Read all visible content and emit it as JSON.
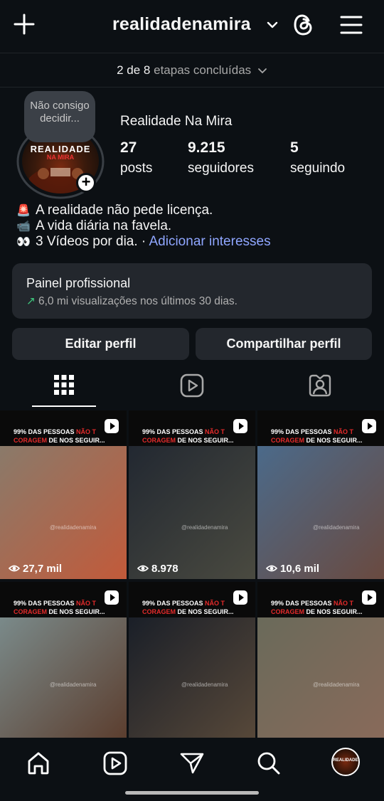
{
  "header": {
    "username": "realidadenamira",
    "icons": [
      "plus-icon",
      "chevron-down-icon",
      "threads-icon",
      "menu-icon"
    ]
  },
  "steps": {
    "done": "2 de 8",
    "rest": "etapas concluídas"
  },
  "profile": {
    "note_bubble": "Não consigo decidir...",
    "avatar_text": "REALIDADE",
    "avatar_sub": "NA MIRA",
    "name": "Realidade Na Mira",
    "stats": [
      {
        "number": "27",
        "label": "posts"
      },
      {
        "number": "9.215",
        "label": "seguidores"
      },
      {
        "number": "5",
        "label": "seguindo"
      }
    ],
    "bio": [
      {
        "icon": "🚨",
        "text": "A realidade não pede licença."
      },
      {
        "icon": "📹",
        "text": "A vida diária na favela."
      },
      {
        "icon": "👀",
        "text": "3 Vídeos por dia. · ",
        "link": "Adicionar interesses"
      }
    ]
  },
  "painel": {
    "title": "Painel profissional",
    "subtitle": "6,0 mi visualizações nos últimos 30 dias."
  },
  "buttons": {
    "edit": "Editar perfil",
    "share": "Compartilhar perfil"
  },
  "tabs": [
    "grid-tab",
    "reels-tab",
    "tagged-tab"
  ],
  "grid": [
    {
      "l1": "99% DAS PESSOAS ",
      "red1": "NÃO T",
      "red2": "CORAGEM",
      "l2": " DE NOS SEGUIR...",
      "views": "27,7 mil",
      "wm": "@realidadenamira",
      "bg1": "#8a7a6a",
      "bg2": "#c25a3a"
    },
    {
      "l1": "99% DAS PESSOAS ",
      "red1": "NÃO T",
      "red2": "CORAGEM",
      "l2": " DE NOS SEGUIR...",
      "views": "8.978",
      "wm": "@realidadenamira",
      "bg1": "#222831",
      "bg2": "#4a4a40"
    },
    {
      "l1": "99% DAS PESSOAS ",
      "red1": "NÃO T",
      "red2": "CORAGEM",
      "l2": " DE NOS SEGUIR...",
      "views": "10,6 mil",
      "wm": "@realidadenamira",
      "bg1": "#4b6a8a",
      "bg2": "#6a4a40"
    },
    {
      "l1": "99% DAS PESSOAS ",
      "red1": "NÃO T",
      "red2": "CORAGEM",
      "l2": " DE NOS SEGUIR...",
      "views": "",
      "wm": "@realidadenamira",
      "bg1": "#7a8a8a",
      "bg2": "#5a3a2a"
    },
    {
      "l1": "99% DAS PESSOAS ",
      "red1": "NÃO T",
      "red2": "CORAGEM",
      "l2": " DE NOS SEGUIR...",
      "views": "",
      "wm": "@realidadenamira",
      "bg1": "#1a1f28",
      "bg2": "#5a4a3a"
    },
    {
      "l1": "99% DAS PESSOAS ",
      "red1": "NÃO T",
      "red2": "CORAGEM",
      "l2": " DE NOS SEGUIR...",
      "views": "",
      "wm": "@realidadenamira",
      "bg1": "#6a6a5a",
      "bg2": "#8a6a5a"
    }
  ],
  "bottom_nav": [
    "home-icon",
    "reels-icon",
    "send-icon",
    "search-icon",
    "profile-avatar"
  ],
  "colors": {
    "background": "#0c1014",
    "card": "#23272d",
    "link": "#8fa6ff",
    "accent_red": "#e52b2b",
    "trend_green": "#3ec47b"
  }
}
